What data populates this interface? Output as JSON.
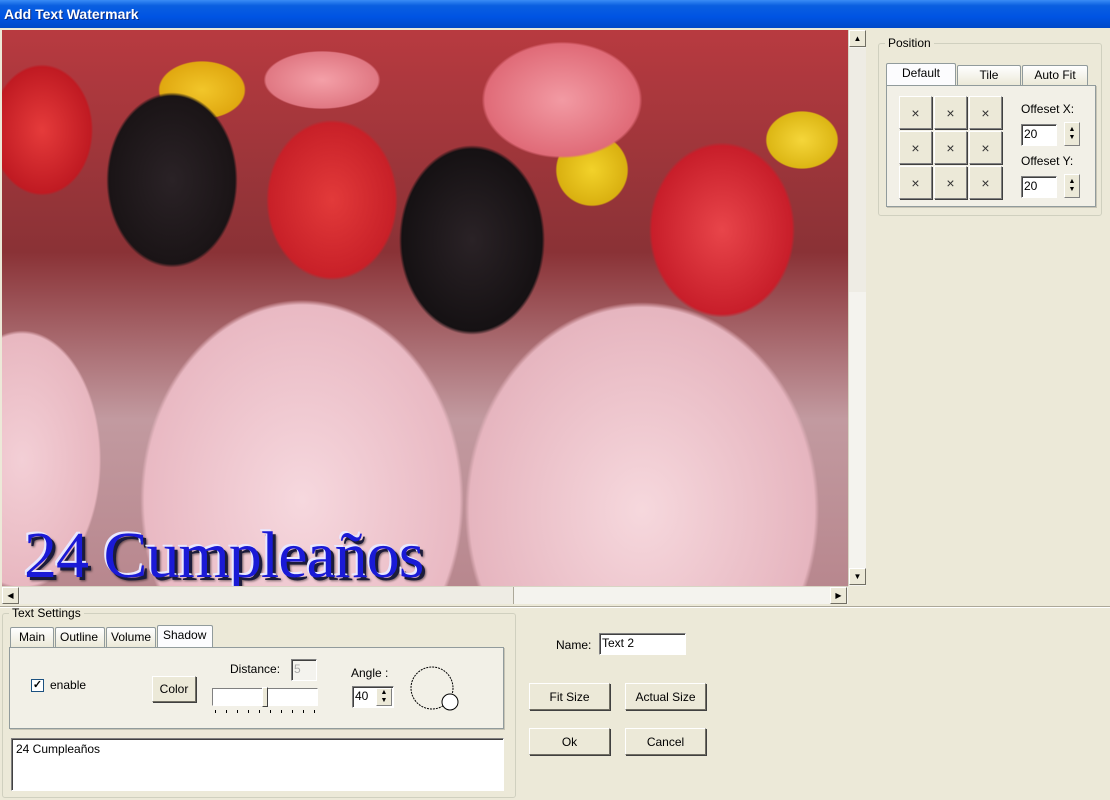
{
  "window": {
    "title": "Add Text Watermark"
  },
  "preview": {
    "watermark_text": "24 Cumpleaños",
    "watermark_color": "#1a1ad6",
    "scroll_up_icon": "▲",
    "scroll_down_icon": "▼",
    "scroll_left_icon": "◀",
    "scroll_right_icon": "▶"
  },
  "position": {
    "legend": "Position",
    "tabs": [
      {
        "label": "Default",
        "active": true
      },
      {
        "label": "Tile",
        "active": false
      },
      {
        "label": "Auto Fit",
        "active": false
      }
    ],
    "grid_buttons": [
      "×",
      "×",
      "×",
      "×",
      "×",
      "×",
      "×",
      "×",
      "×"
    ],
    "offset_x_label": "Offeset X:",
    "offset_x_value": "20",
    "offset_y_label": "Offeset Y:",
    "offset_y_value": "20",
    "spin_up": "▲",
    "spin_down": "▼"
  },
  "text_settings": {
    "legend": "Text Settings",
    "tabs": [
      {
        "label": "Main",
        "active": false
      },
      {
        "label": "Outline",
        "active": false
      },
      {
        "label": "Volume",
        "active": false
      },
      {
        "label": "Shadow",
        "active": true
      }
    ],
    "shadow": {
      "enable_label": "enable",
      "enable_checked": true,
      "check_mark": "✓",
      "color_button": "Color",
      "distance_label": "Distance:",
      "distance_value": "5",
      "distance_slider_fraction": 0.5,
      "angle_label": "Angle :",
      "angle_value": "40"
    },
    "text_content": "24 Cumpleaños"
  },
  "side": {
    "name_label": "Name:",
    "name_value": "Text 2",
    "fit_size_button": "Fit Size",
    "actual_size_button": "Actual Size",
    "ok_button": "Ok",
    "cancel_button": "Cancel"
  }
}
